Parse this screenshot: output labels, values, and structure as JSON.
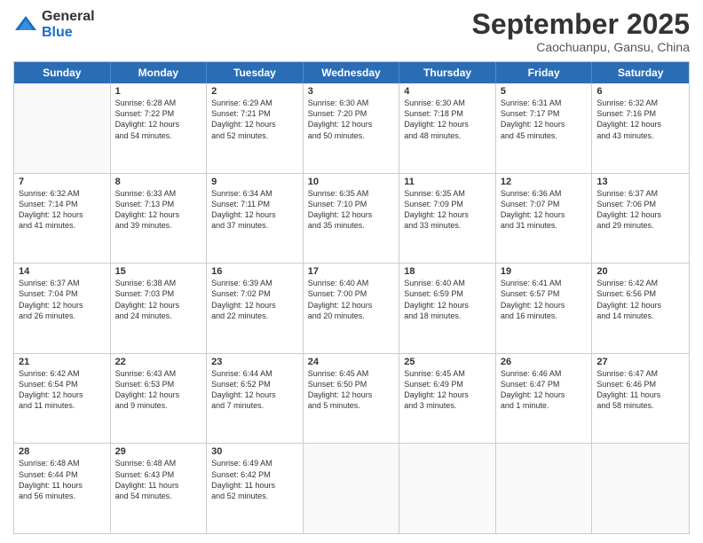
{
  "logo": {
    "general": "General",
    "blue": "Blue"
  },
  "header": {
    "month": "September 2025",
    "location": "Caochuanpu, Gansu, China"
  },
  "days": [
    "Sunday",
    "Monday",
    "Tuesday",
    "Wednesday",
    "Thursday",
    "Friday",
    "Saturday"
  ],
  "weeks": [
    [
      {
        "day": "",
        "data": ""
      },
      {
        "day": "1",
        "data": "Sunrise: 6:28 AM\nSunset: 7:22 PM\nDaylight: 12 hours\nand 54 minutes."
      },
      {
        "day": "2",
        "data": "Sunrise: 6:29 AM\nSunset: 7:21 PM\nDaylight: 12 hours\nand 52 minutes."
      },
      {
        "day": "3",
        "data": "Sunrise: 6:30 AM\nSunset: 7:20 PM\nDaylight: 12 hours\nand 50 minutes."
      },
      {
        "day": "4",
        "data": "Sunrise: 6:30 AM\nSunset: 7:18 PM\nDaylight: 12 hours\nand 48 minutes."
      },
      {
        "day": "5",
        "data": "Sunrise: 6:31 AM\nSunset: 7:17 PM\nDaylight: 12 hours\nand 45 minutes."
      },
      {
        "day": "6",
        "data": "Sunrise: 6:32 AM\nSunset: 7:16 PM\nDaylight: 12 hours\nand 43 minutes."
      }
    ],
    [
      {
        "day": "7",
        "data": "Sunrise: 6:32 AM\nSunset: 7:14 PM\nDaylight: 12 hours\nand 41 minutes."
      },
      {
        "day": "8",
        "data": "Sunrise: 6:33 AM\nSunset: 7:13 PM\nDaylight: 12 hours\nand 39 minutes."
      },
      {
        "day": "9",
        "data": "Sunrise: 6:34 AM\nSunset: 7:11 PM\nDaylight: 12 hours\nand 37 minutes."
      },
      {
        "day": "10",
        "data": "Sunrise: 6:35 AM\nSunset: 7:10 PM\nDaylight: 12 hours\nand 35 minutes."
      },
      {
        "day": "11",
        "data": "Sunrise: 6:35 AM\nSunset: 7:09 PM\nDaylight: 12 hours\nand 33 minutes."
      },
      {
        "day": "12",
        "data": "Sunrise: 6:36 AM\nSunset: 7:07 PM\nDaylight: 12 hours\nand 31 minutes."
      },
      {
        "day": "13",
        "data": "Sunrise: 6:37 AM\nSunset: 7:06 PM\nDaylight: 12 hours\nand 29 minutes."
      }
    ],
    [
      {
        "day": "14",
        "data": "Sunrise: 6:37 AM\nSunset: 7:04 PM\nDaylight: 12 hours\nand 26 minutes."
      },
      {
        "day": "15",
        "data": "Sunrise: 6:38 AM\nSunset: 7:03 PM\nDaylight: 12 hours\nand 24 minutes."
      },
      {
        "day": "16",
        "data": "Sunrise: 6:39 AM\nSunset: 7:02 PM\nDaylight: 12 hours\nand 22 minutes."
      },
      {
        "day": "17",
        "data": "Sunrise: 6:40 AM\nSunset: 7:00 PM\nDaylight: 12 hours\nand 20 minutes."
      },
      {
        "day": "18",
        "data": "Sunrise: 6:40 AM\nSunset: 6:59 PM\nDaylight: 12 hours\nand 18 minutes."
      },
      {
        "day": "19",
        "data": "Sunrise: 6:41 AM\nSunset: 6:57 PM\nDaylight: 12 hours\nand 16 minutes."
      },
      {
        "day": "20",
        "data": "Sunrise: 6:42 AM\nSunset: 6:56 PM\nDaylight: 12 hours\nand 14 minutes."
      }
    ],
    [
      {
        "day": "21",
        "data": "Sunrise: 6:42 AM\nSunset: 6:54 PM\nDaylight: 12 hours\nand 11 minutes."
      },
      {
        "day": "22",
        "data": "Sunrise: 6:43 AM\nSunset: 6:53 PM\nDaylight: 12 hours\nand 9 minutes."
      },
      {
        "day": "23",
        "data": "Sunrise: 6:44 AM\nSunset: 6:52 PM\nDaylight: 12 hours\nand 7 minutes."
      },
      {
        "day": "24",
        "data": "Sunrise: 6:45 AM\nSunset: 6:50 PM\nDaylight: 12 hours\nand 5 minutes."
      },
      {
        "day": "25",
        "data": "Sunrise: 6:45 AM\nSunset: 6:49 PM\nDaylight: 12 hours\nand 3 minutes."
      },
      {
        "day": "26",
        "data": "Sunrise: 6:46 AM\nSunset: 6:47 PM\nDaylight: 12 hours\nand 1 minute."
      },
      {
        "day": "27",
        "data": "Sunrise: 6:47 AM\nSunset: 6:46 PM\nDaylight: 11 hours\nand 58 minutes."
      }
    ],
    [
      {
        "day": "28",
        "data": "Sunrise: 6:48 AM\nSunset: 6:44 PM\nDaylight: 11 hours\nand 56 minutes."
      },
      {
        "day": "29",
        "data": "Sunrise: 6:48 AM\nSunset: 6:43 PM\nDaylight: 11 hours\nand 54 minutes."
      },
      {
        "day": "30",
        "data": "Sunrise: 6:49 AM\nSunset: 6:42 PM\nDaylight: 11 hours\nand 52 minutes."
      },
      {
        "day": "",
        "data": ""
      },
      {
        "day": "",
        "data": ""
      },
      {
        "day": "",
        "data": ""
      },
      {
        "day": "",
        "data": ""
      }
    ]
  ]
}
